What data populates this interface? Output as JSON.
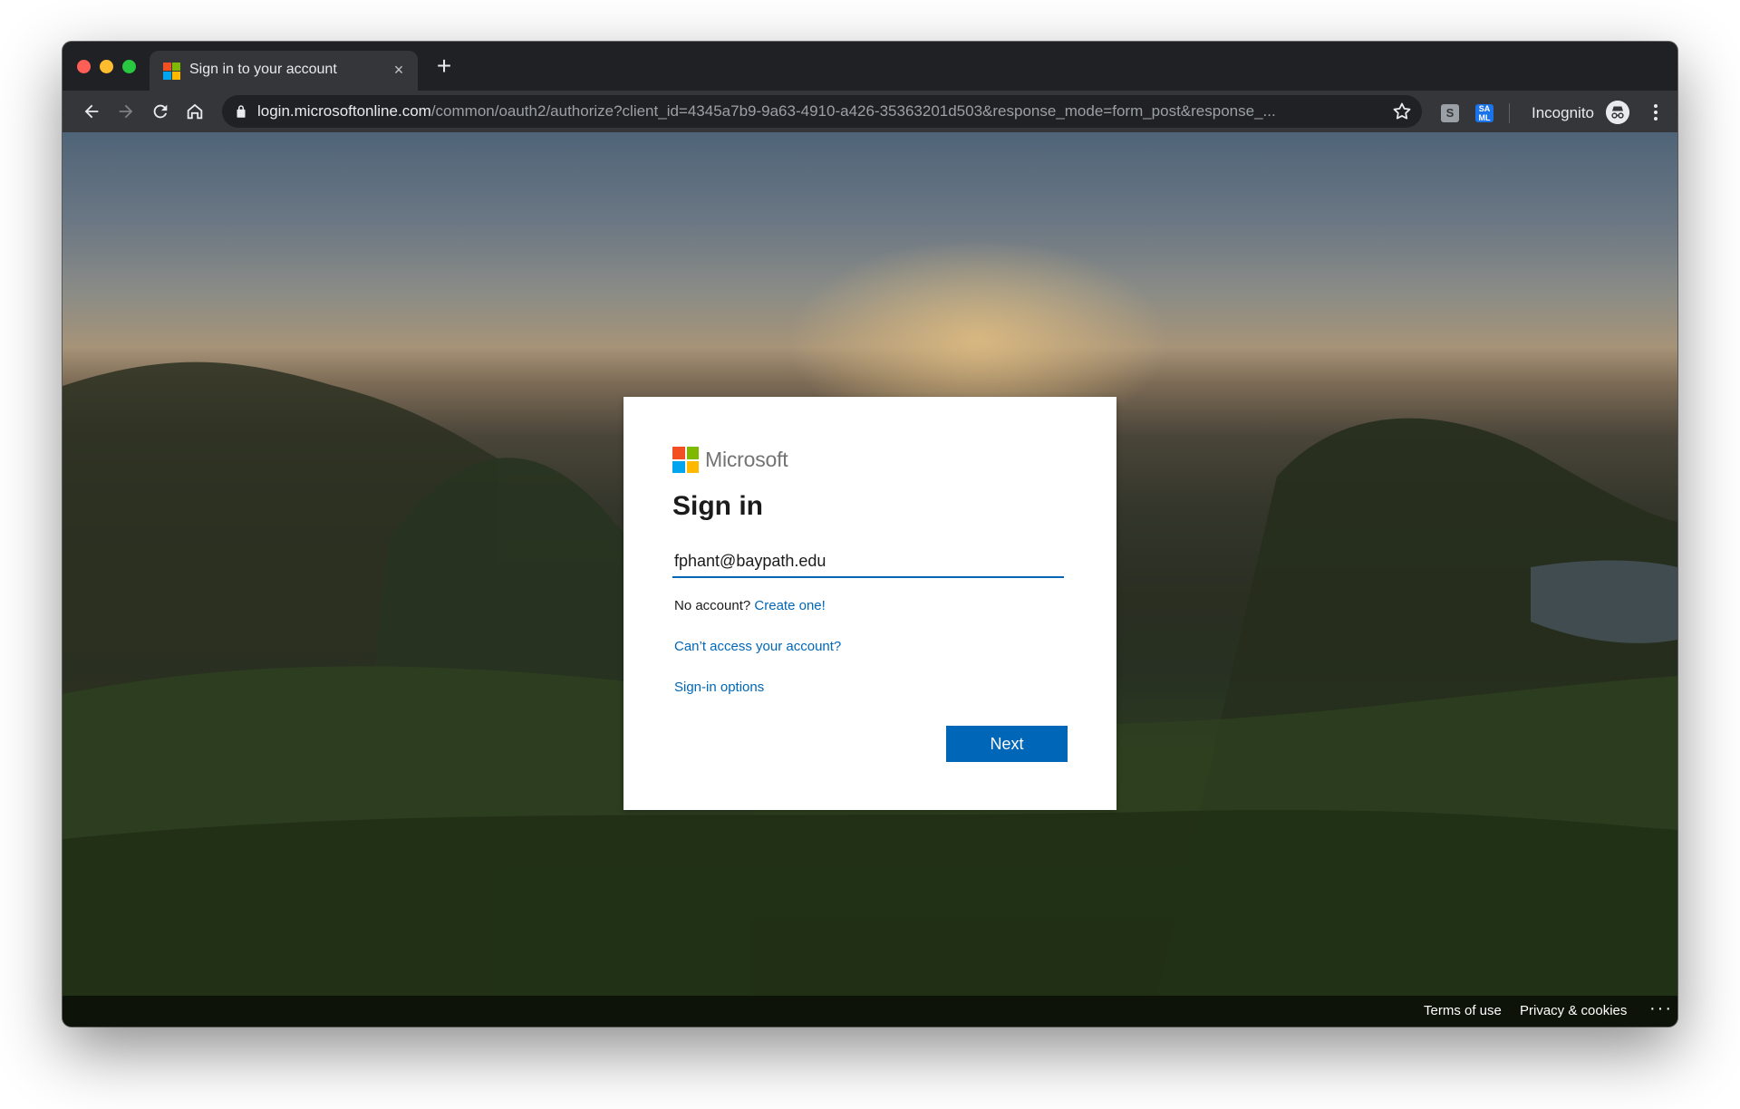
{
  "browser": {
    "tab": {
      "title": "Sign in to your account",
      "close_glyph": "×",
      "favicon": "microsoft-logo-icon"
    },
    "new_tab_glyph": "+",
    "address_bar": {
      "host": "login.microsoftonline.com",
      "path": "/common/oauth2/authorize?client_id=4345a7b9-9a63-4910-a426-35363201d503&response_mode=form_post&response_..."
    },
    "extensions": {
      "s_label": "S",
      "saml_label": "SA ML"
    },
    "profile_label": "Incognito"
  },
  "signin": {
    "brand": "Microsoft",
    "title": "Sign in",
    "email_value": "fphant@baypath.edu",
    "no_account_text": "No account?",
    "create_link": "Create one!",
    "cant_access_link": "Can’t access your account?",
    "signin_options_link": "Sign-in options",
    "next_label": "Next"
  },
  "footer": {
    "terms": "Terms of use",
    "privacy": "Privacy & cookies",
    "more": "···"
  },
  "colors": {
    "accent": "#0067b8",
    "logo_red": "#f25022",
    "logo_green": "#7fba00",
    "logo_blue": "#00a4ef",
    "logo_yellow": "#ffb900"
  }
}
